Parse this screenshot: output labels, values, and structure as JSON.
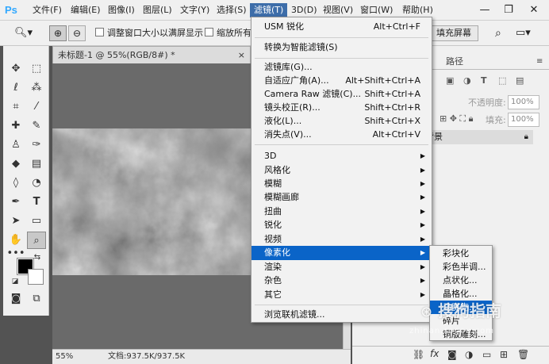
{
  "app": {
    "logo": "Ps"
  },
  "menubar": {
    "items": [
      "文件(F)",
      "编辑(E)",
      "图像(I)",
      "图层(L)",
      "文字(Y)",
      "选择(S)",
      "滤镜(T)",
      "3D(D)",
      "视图(V)",
      "窗口(W)",
      "帮助(H)"
    ],
    "active_index": 6,
    "window_controls": {
      "minimize": "—",
      "restore": "❐",
      "close": "✕"
    }
  },
  "options_bar": {
    "tool_icon": "zoom-icon",
    "resize_windows_label": "调整窗口大小以满屏显示",
    "zoom_all_label": "缩放所有",
    "fill_screen_label": "填充屏幕"
  },
  "document": {
    "tab_title": "未标题-1 @ 55%(RGB/8#) *",
    "tab_close": "×",
    "zoom": "55%",
    "doc_info": "文档:937.5K/937.5K"
  },
  "right_panel": {
    "tabs": [
      "路径"
    ],
    "opacity_label": "不透明度:",
    "opacity_value": "100%",
    "fill_label": "填充:",
    "fill_value": "100%",
    "layer_name": "背景",
    "bottom_fx": "fx"
  },
  "filter_menu": {
    "top_items": [
      {
        "label": "USM 锐化",
        "shortcut": "Alt+Ctrl+F"
      },
      {
        "label": "转换为智能滤镜(S)",
        "shortcut": ""
      },
      {
        "label": "滤镜库(G)...",
        "shortcut": ""
      },
      {
        "label": "自适应广角(A)...",
        "shortcut": "Alt+Shift+Ctrl+A"
      },
      {
        "label": "Camera Raw 滤镜(C)...",
        "shortcut": "Shift+Ctrl+A"
      },
      {
        "label": "镜头校正(R)...",
        "shortcut": "Shift+Ctrl+R"
      },
      {
        "label": "液化(L)...",
        "shortcut": "Shift+Ctrl+X"
      },
      {
        "label": "消失点(V)...",
        "shortcut": "Alt+Ctrl+V"
      }
    ],
    "sub_items": [
      "3D",
      "风格化",
      "模糊",
      "模糊画廊",
      "扭曲",
      "锐化",
      "视频",
      "像素化",
      "渲染",
      "杂色",
      "其它"
    ],
    "highlight_sub_index": 7,
    "browse_label": "浏览联机滤镜..."
  },
  "pixelate_submenu": {
    "items": [
      "彩块化",
      "彩色半调...",
      "点状化...",
      "晶格化...",
      "马赛克...",
      "碎片",
      "铜版雕刻..."
    ],
    "highlight_index": 4
  },
  "watermark": {
    "text": "搜狗指南",
    "sub": "zhinan.sogou.com"
  }
}
